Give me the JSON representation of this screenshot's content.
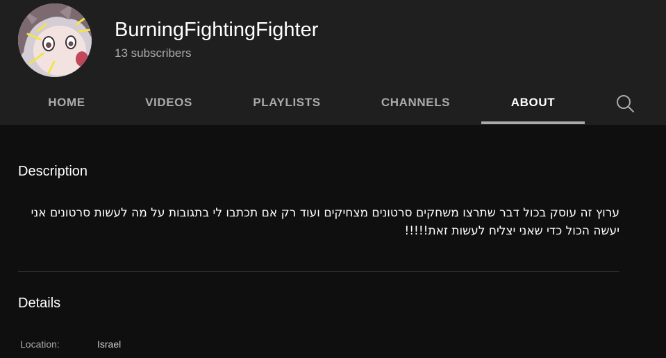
{
  "channel": {
    "name": "BurningFightingFighter",
    "subscribers": "13 subscribers"
  },
  "tabs": [
    {
      "label": "HOME"
    },
    {
      "label": "VIDEOS"
    },
    {
      "label": "PLAYLISTS"
    },
    {
      "label": "CHANNELS"
    },
    {
      "label": "ABOUT",
      "active": true
    }
  ],
  "icons": {
    "search": "search-icon",
    "avatar": "avatar-image"
  },
  "about": {
    "description_title": "Description",
    "description_text": "ערוץ זה עוסק בכול דבר שתרצו משחקים סרטונים מצחיקים ועוד רק אם תכתבו לי בתגובות על מה לעשות סרטונים אני יעשה הכול כדי שאני יצליח לעשות זאת!!!!!",
    "details_title": "Details",
    "location_label": "Location:",
    "location_value": "Israel"
  },
  "colors": {
    "header_bg": "#1f1f1f",
    "page_bg": "#0f0f0f",
    "muted_text": "#aaaaaa",
    "tab_underline": "#aaaaaa"
  }
}
